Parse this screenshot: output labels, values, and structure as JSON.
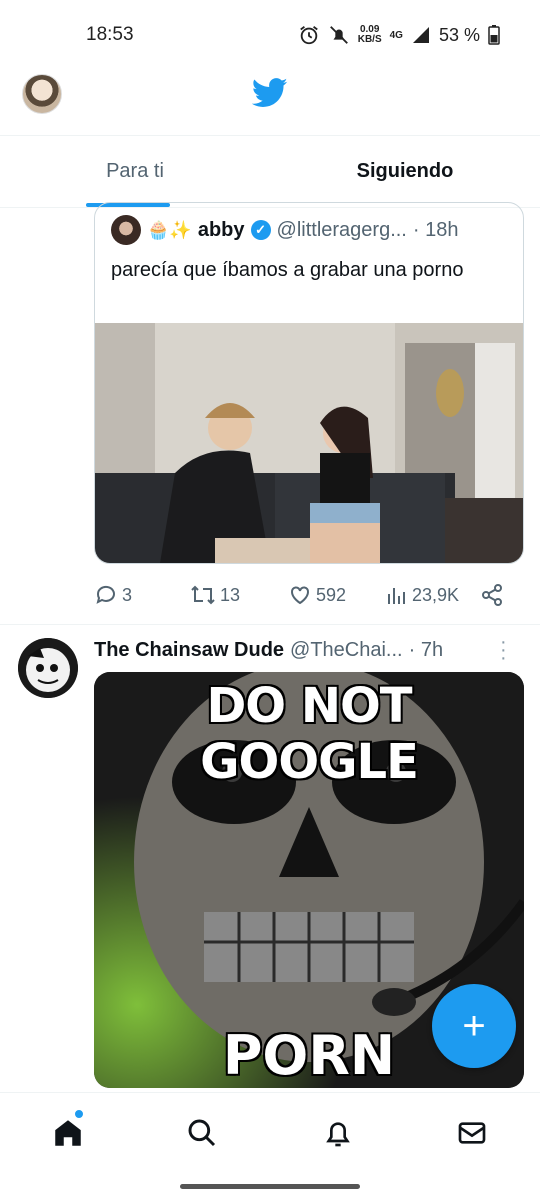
{
  "status_bar": {
    "time": "18:53",
    "speed_value": "0.09",
    "speed_unit": "KB/S",
    "network": "4G",
    "battery": "53 %"
  },
  "top_bar": {
    "logo": "twitter-bird-icon"
  },
  "tabs": [
    {
      "label": "Para ti",
      "active": true
    },
    {
      "label": "Siguiendo",
      "active": false
    }
  ],
  "quoted_tweet": {
    "emojis": "🧁✨",
    "name": "abby",
    "handle": "@littleragerg...",
    "time": "· 18h",
    "text": "parecía que íbamos a grabar una porno"
  },
  "actions": {
    "replies": "3",
    "retweets": "13",
    "likes": "592",
    "views": "23,9K"
  },
  "tweet2": {
    "name": "The Chainsaw Dude",
    "handle": "@TheChai...",
    "time": "· 7h",
    "meme_top": "DO NOT GOOGLE",
    "meme_bottom": "PORN"
  },
  "fab": {
    "label": "+"
  },
  "colors": {
    "accent": "#1d9bf0",
    "secondary_text": "#536471"
  }
}
